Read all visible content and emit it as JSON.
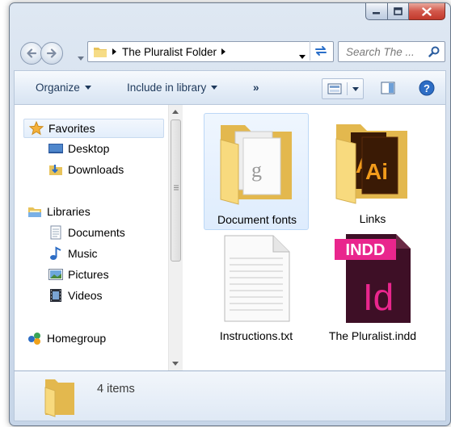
{
  "window": {
    "caption_buttons": {
      "minimize_icon": "minimize-icon",
      "maximize_icon": "maximize-icon",
      "close_icon": "close-icon"
    }
  },
  "address_bar": {
    "crumbs": [
      "The Pluralist Folder"
    ],
    "search_placeholder": "Search The ..."
  },
  "toolbar": {
    "organize_label": "Organize",
    "include_label": "Include in library",
    "more_label": "»"
  },
  "nav_pane": {
    "favorites": {
      "label": "Favorites",
      "items": [
        "Desktop",
        "Downloads"
      ]
    },
    "libraries": {
      "label": "Libraries",
      "items": [
        "Documents",
        "Music",
        "Pictures",
        "Videos"
      ]
    },
    "homegroup": {
      "label": "Homegroup"
    }
  },
  "files": [
    {
      "name": "Document fonts",
      "type": "folder",
      "selected": true
    },
    {
      "name": "Links",
      "type": "folder",
      "selected": false
    },
    {
      "name": "Instructions.txt",
      "type": "text-file",
      "selected": false
    },
    {
      "name": "The Pluralist.indd",
      "type": "indesign-file",
      "badge": "INDD",
      "glyph": "Id",
      "selected": false
    }
  ],
  "details": {
    "item_count": "4 items"
  },
  "colors": {
    "indesign_magenta": "#e9268d",
    "indesign_dark": "#3e0f26",
    "folder_yellow": "#f4d77a",
    "selection_blue": "#deecfd"
  }
}
